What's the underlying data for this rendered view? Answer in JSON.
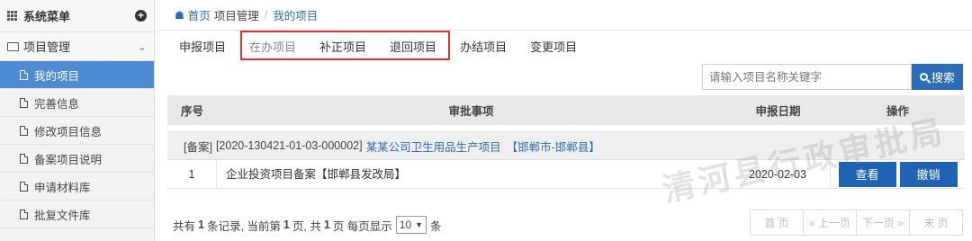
{
  "sidebar": {
    "header_title": "系统菜单",
    "group_label": "项目管理",
    "items": [
      {
        "label": "我的项目"
      },
      {
        "label": "完善信息"
      },
      {
        "label": "修改项目信息"
      },
      {
        "label": "备案项目说明"
      },
      {
        "label": "申请材料库"
      },
      {
        "label": "批复文件库"
      }
    ]
  },
  "breadcrumb": {
    "home": "首页",
    "section": "项目管理",
    "current": "我的项目"
  },
  "tabs": [
    "申报项目",
    "在办项目",
    "补正项目",
    "退回项目",
    "办结项目",
    "变更项目"
  ],
  "search": {
    "placeholder": "请输入项目名称关键字",
    "button_label": "搜索"
  },
  "table": {
    "headers": [
      "序号",
      "审批事项",
      "申报日期",
      "操作"
    ],
    "group": {
      "prefix": "[备案]",
      "code": "[2020-130421-01-03-000002]",
      "name": "某某公司卫生用品生产项目",
      "region": "【邯郸市-邯郸县】"
    },
    "rows": [
      {
        "index": "1",
        "item": "企业投资项目备案【邯郸县发改局】",
        "date": "2020-02-03",
        "view_label": "查看",
        "revoke_label": "撤销"
      }
    ]
  },
  "pagination": {
    "t1": "共有",
    "total_records": "1",
    "t2": "条记录, 当前第",
    "current_page": "1",
    "t3": "页, 共",
    "total_pages": "1",
    "t4": "页 每页显示",
    "page_size": "10",
    "t5": "条",
    "first": "首 页",
    "prev": "« 上一页",
    "next": "下一页 »",
    "last": "末 页"
  },
  "watermark": "清河县行政审批局",
  "colors": {
    "accent": "#2d6db7",
    "active_sidebar": "#4d8bd3",
    "highlight_border": "#e0302a"
  }
}
